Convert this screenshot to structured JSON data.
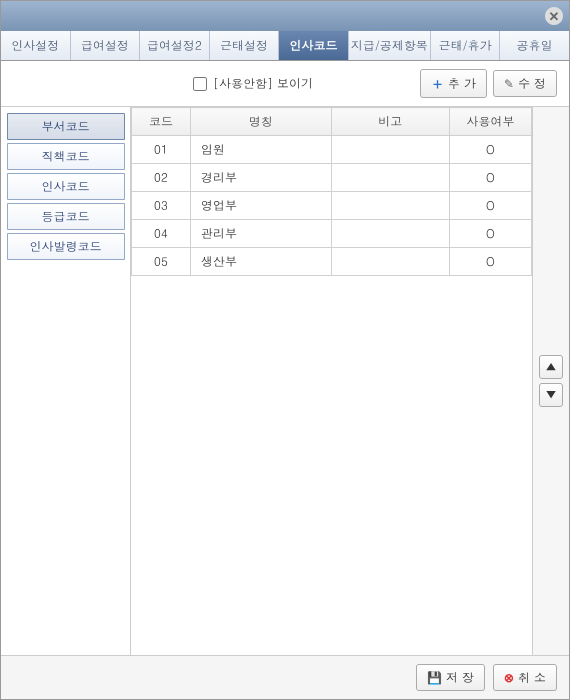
{
  "tabs": [
    {
      "label": "인사설정"
    },
    {
      "label": "급여설정"
    },
    {
      "label": "급여설정2"
    },
    {
      "label": "근태설정"
    },
    {
      "label": "인사코드",
      "active": true
    },
    {
      "label": "지급/공제항목"
    },
    {
      "label": "근태/휴가"
    },
    {
      "label": "공휴일"
    }
  ],
  "toolbar": {
    "show_unused_label": "[사용안함] 보이기",
    "add_label": "추 가",
    "edit_label": "수 정"
  },
  "sidebar": {
    "items": [
      {
        "label": "부서코드",
        "active": true
      },
      {
        "label": "직책코드"
      },
      {
        "label": "인사코드"
      },
      {
        "label": "등급코드"
      },
      {
        "label": "인사발령코드"
      }
    ]
  },
  "table": {
    "headers": {
      "code": "코드",
      "name": "명칭",
      "remark": "비고",
      "use": "사용여부"
    },
    "rows": [
      {
        "code": "01",
        "name": "임원",
        "remark": "",
        "use": "O"
      },
      {
        "code": "02",
        "name": "경리부",
        "remark": "",
        "use": "O"
      },
      {
        "code": "03",
        "name": "영업부",
        "remark": "",
        "use": "O"
      },
      {
        "code": "04",
        "name": "관리부",
        "remark": "",
        "use": "O"
      },
      {
        "code": "05",
        "name": "생산부",
        "remark": "",
        "use": "O"
      }
    ]
  },
  "footer": {
    "save_label": "저 장",
    "cancel_label": "취 소"
  }
}
